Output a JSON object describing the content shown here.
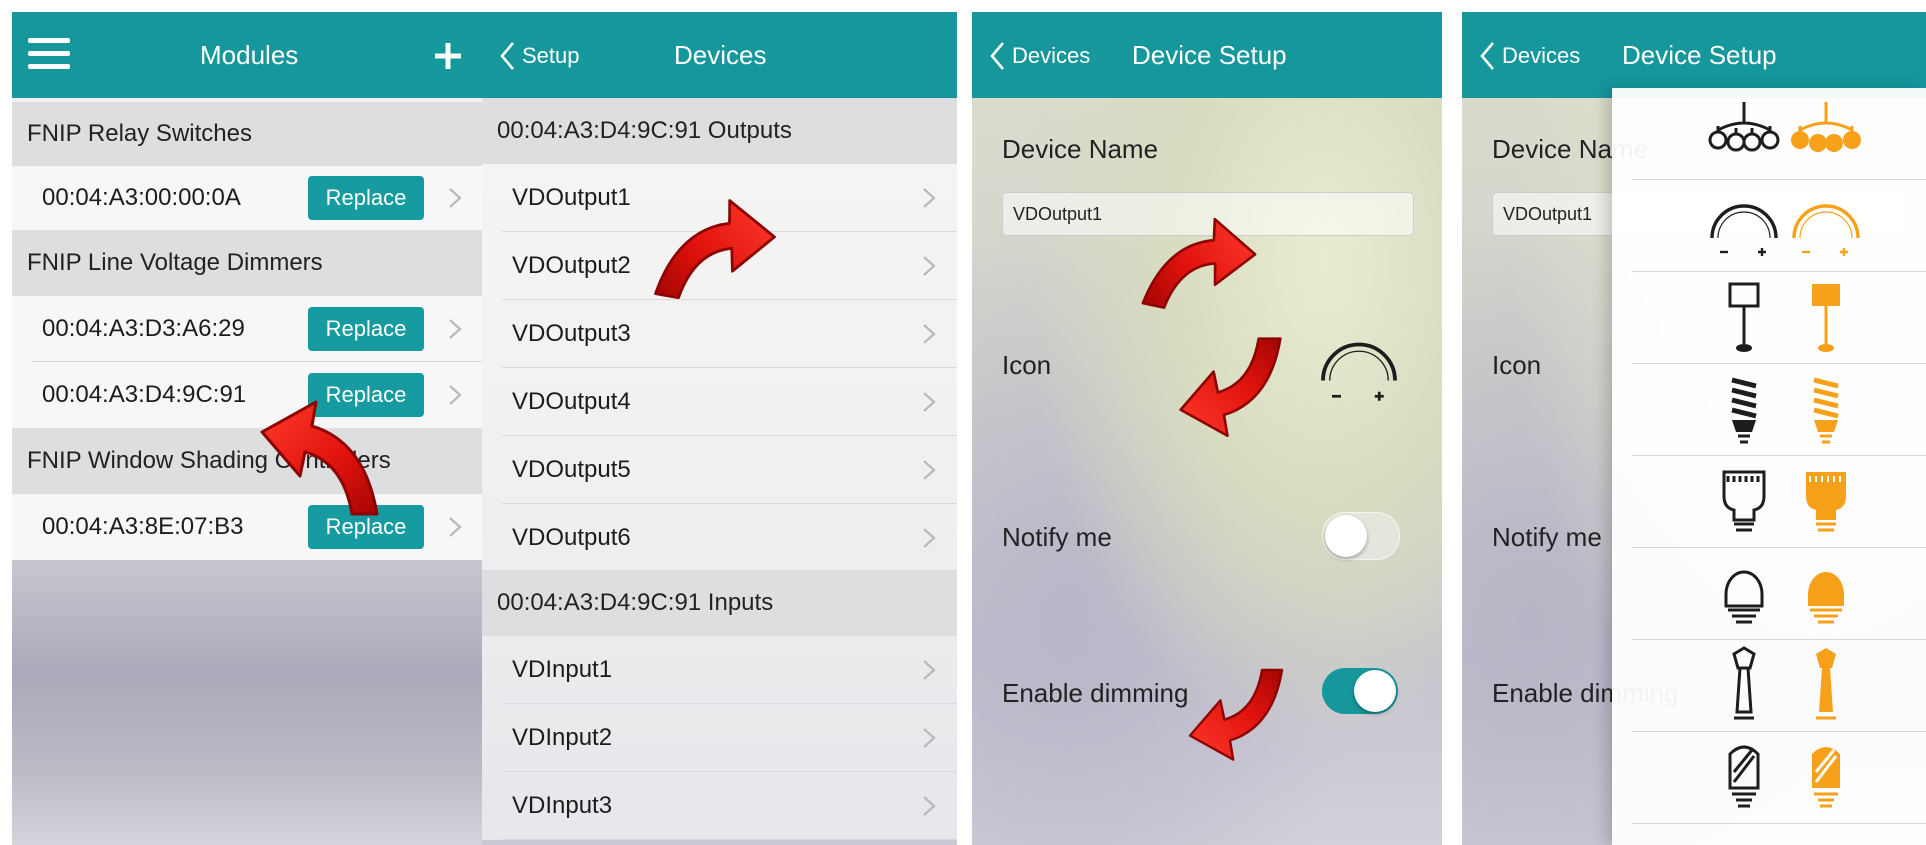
{
  "colors": {
    "teal": "#15979c",
    "button": "#169ba1",
    "orange": "#f7a11a",
    "arrow_red": "#e0120d"
  },
  "panel1": {
    "title": "Modules",
    "menu_icon": "hamburger-menu-icon",
    "add_icon": "plus-icon",
    "sections": [
      {
        "title": "FNIP Relay Switches",
        "rows": [
          {
            "address": "00:04:A3:00:00:0A",
            "button": "Replace"
          }
        ]
      },
      {
        "title": "FNIP Line Voltage Dimmers",
        "rows": [
          {
            "address": "00:04:A3:D3:A6:29",
            "button": "Replace"
          },
          {
            "address": "00:04:A3:D4:9C:91",
            "button": "Replace"
          }
        ]
      },
      {
        "title": "FNIP Window Shading Controllers",
        "rows": [
          {
            "address": "00:04:A3:8E:07:B3",
            "button": "Replace"
          }
        ]
      }
    ]
  },
  "panel2": {
    "back": "Setup",
    "title": "Devices",
    "outputs_header": "00:04:A3:D4:9C:91 Outputs",
    "outputs": [
      "VDOutput1",
      "VDOutput2",
      "VDOutput3",
      "VDOutput4",
      "VDOutput5",
      "VDOutput6"
    ],
    "inputs_header": "00:04:A3:D4:9C:91 Inputs",
    "inputs": [
      "VDInput1",
      "VDInput2",
      "VDInput3"
    ]
  },
  "panel3": {
    "back": "Devices",
    "title": "Device Setup",
    "device_name_label": "Device Name",
    "device_name_value": "VDOutput1",
    "icon_label": "Icon",
    "icon_name": "dimmer-arc-icon",
    "notify_label": "Notify me",
    "notify_on": false,
    "dimming_label": "Enable dimming",
    "dimming_on": true
  },
  "panel4": {
    "back": "Devices",
    "title": "Device Setup",
    "device_name_label": "Device Name",
    "device_name_value": "VDOutput1",
    "icon_label": "Icon",
    "notify_label": "Notify me",
    "dimming_label": "Enable dimming",
    "icon_options": [
      "chandelier",
      "dimmer-arc",
      "floor-lamp",
      "cfl-bulb",
      "led-bulb",
      "halogen-bulb",
      "lamp-post",
      "tube-bulb"
    ]
  }
}
